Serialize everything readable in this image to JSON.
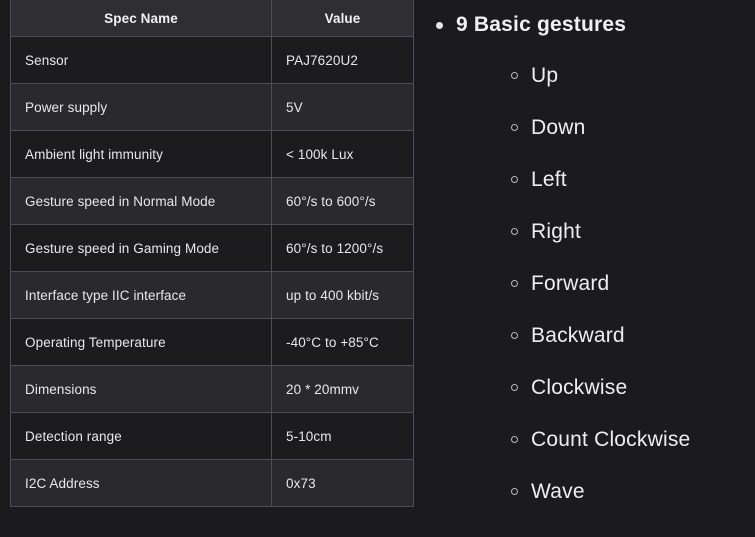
{
  "spec_table": {
    "columns": [
      "Spec Name",
      "Value"
    ],
    "rows": [
      {
        "name": "Sensor",
        "value": "PAJ7620U2"
      },
      {
        "name": "Power supply",
        "value": "5V"
      },
      {
        "name": "Ambient light immunity",
        "value": "< 100k Lux"
      },
      {
        "name": "Gesture speed in Normal Mode",
        "value": "60°/s to 600°/s"
      },
      {
        "name": "Gesture speed in Gaming Mode",
        "value": "60°/s to 1200°/s"
      },
      {
        "name": "Interface type IIC interface",
        "value": "up to 400 kbit/s"
      },
      {
        "name": "Operating Temperature",
        "value": "-40°C to +85°C"
      },
      {
        "name": "Dimensions",
        "value": "20 * 20mmv"
      },
      {
        "name": "Detection range",
        "value": "5-10cm"
      },
      {
        "name": "I2C Address",
        "value": "0x73"
      }
    ]
  },
  "gesture_list": {
    "heading": "9 Basic gestures",
    "items": [
      "Up",
      "Down",
      "Left",
      "Right",
      "Forward",
      "Backward",
      "Clockwise",
      "Count Clockwise",
      "Wave"
    ]
  },
  "colors": {
    "page_background": "#1b1b1e",
    "table_header_background": "#2e2e33",
    "row_odd_background": "#1c1c1f",
    "row_even_background": "#2a2a2e",
    "border": "#4a4f5a",
    "text": "#e8e8ea"
  }
}
